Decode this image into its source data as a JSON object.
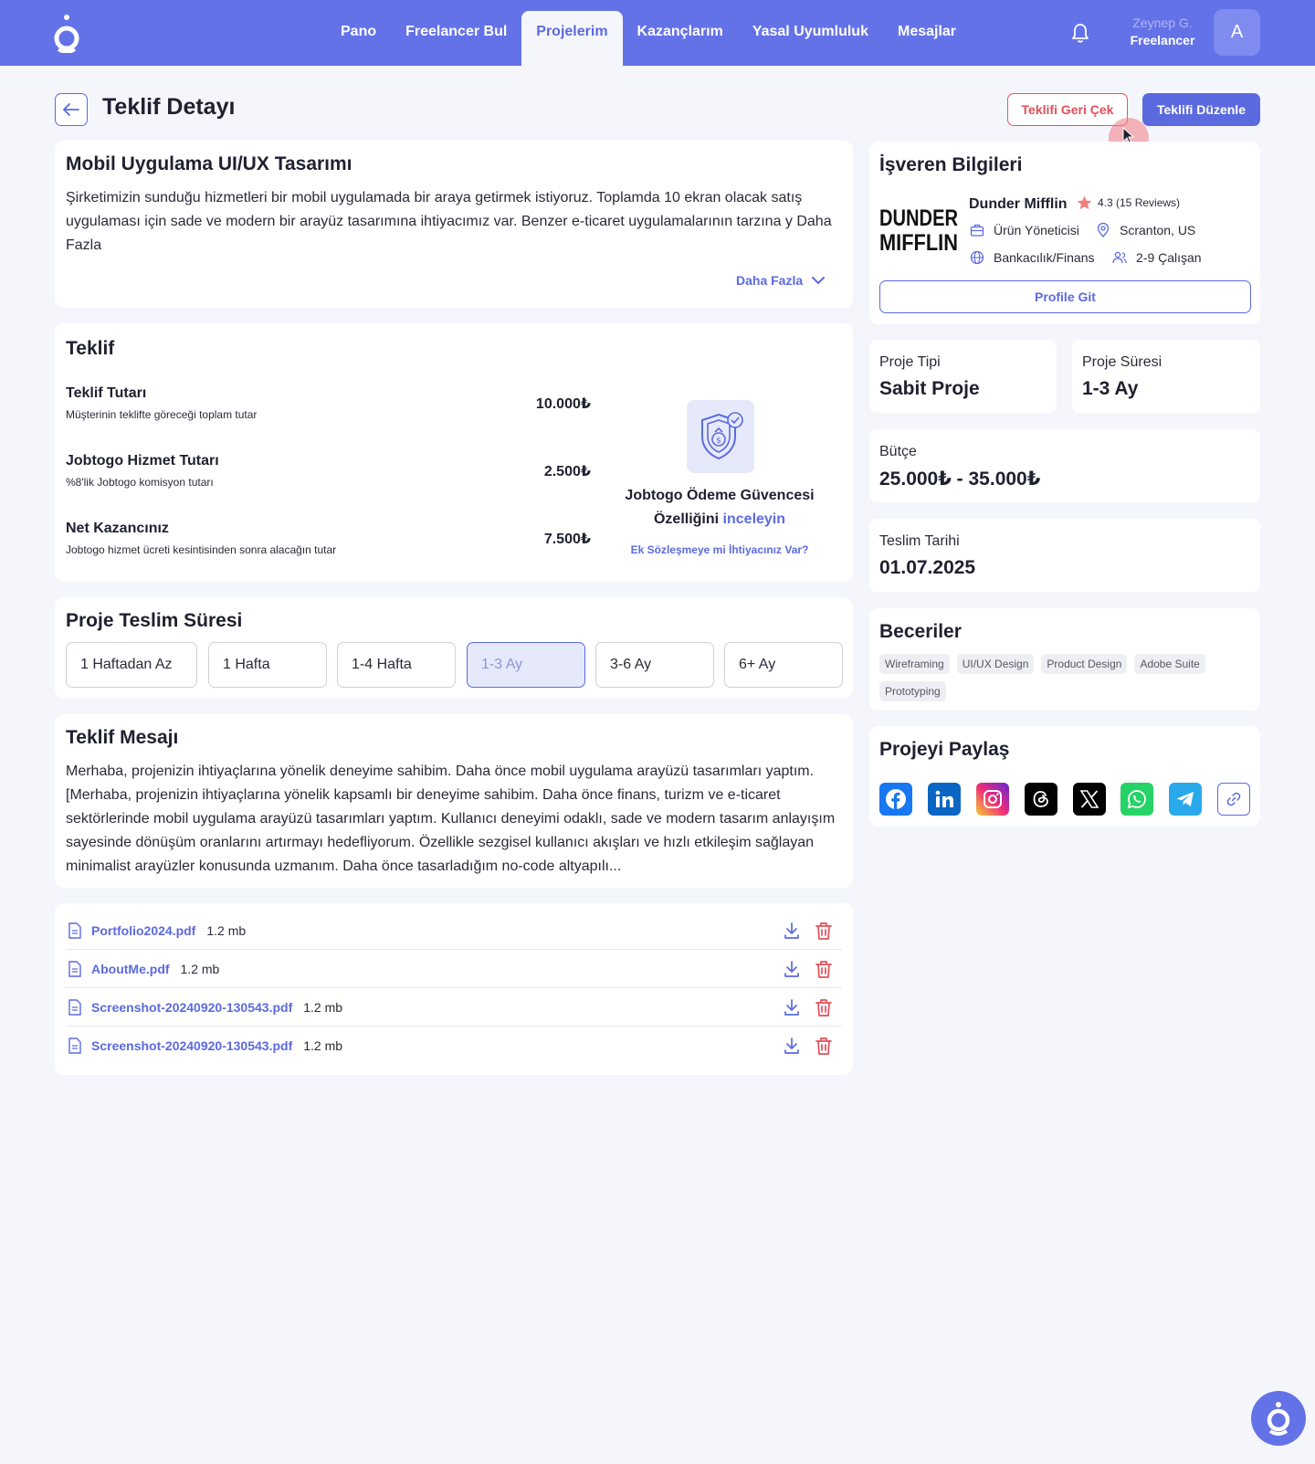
{
  "header": {
    "nav": [
      "Pano",
      "Freelancer Bul",
      "Projelerim",
      "Kazançlarım",
      "Yasal Uyumluluk",
      "Mesajlar"
    ],
    "active_nav": "Projelerim",
    "user_name": "Zeynep G.",
    "user_role": "Freelancer",
    "avatar_initial": "A"
  },
  "page": {
    "title": "Teklif Detayı",
    "withdraw_label": "Teklifi Geri Çek",
    "edit_label": "Teklifi Düzenle"
  },
  "project": {
    "title": "Mobil Uygulama UI/UX Tasarımı",
    "description": "Şirketimizin sunduğu hizmetleri bir mobil uygulamada bir araya getirmek istiyoruz. Toplamda 10 ekran olacak satış uygulaması için sade ve modern bir arayüz tasarımına ihtiyacımız var. Benzer e-ticaret uygulamalarının tarzına y Daha Fazla",
    "more_label": "Daha Fazla"
  },
  "offer": {
    "title": "Teklif",
    "rows": [
      {
        "label": "Teklif Tutarı",
        "sub": "Müşterinin teklifte göreceği toplam tutar",
        "value": "10.000₺"
      },
      {
        "label": "Jobtogo Hizmet Tutarı",
        "sub": "%8'lik Jobtogo komisyon tutarı",
        "value": "2.500₺"
      },
      {
        "label": "Net Kazancınız",
        "sub": "Jobtogo hizmet ücreti kesintisinden sonra alacağın tutar",
        "value": "7.500₺"
      }
    ],
    "guarantee_line1": "Jobtogo Ödeme Güvencesi",
    "guarantee_line2": "Özelliğini",
    "guarantee_link": "inceleyin",
    "contract_link": "Ek Sözleşmeye mi İhtiyacınız Var?"
  },
  "duration": {
    "title": "Proje Teslim Süresi",
    "options": [
      "1 Haftadan Az",
      "1 Hafta",
      "1-4 Hafta",
      "1-3 Ay",
      "3-6 Ay",
      "6+ Ay"
    ],
    "selected": "1-3 Ay"
  },
  "message": {
    "title": "Teklif Mesajı",
    "text": "Merhaba, projenizin ihtiyaçlarına yönelik  deneyime sahibim. Daha önce mobil uygulama arayüzü tasarımları yaptım.[Merhaba, projenizin ihtiyaçlarına yönelik kapsamlı bir deneyime sahibim. Daha önce finans, turizm ve e-ticaret sektörlerinde mobil uygulama arayüzü tasarımları yaptım. Kullanıcı deneyimi odaklı, sade ve modern tasarım anlayışım sayesinde dönüşüm oranlarını artırmayı hedefliyorum. Özellikle sezgisel kullanıcı akışları ve hızlı etkileşim sağlayan minimalist arayüzler konusunda uzmanım. Daha önce tasarladığım no-code altyapılı..."
  },
  "files": [
    {
      "name": "Portfolio2024.pdf",
      "size": "1.2 mb"
    },
    {
      "name": "AboutMe.pdf",
      "size": "1.2 mb"
    },
    {
      "name": "Screenshot-20240920-130543.pdf",
      "size": "1.2 mb"
    },
    {
      "name": "Screenshot-20240920-130543.pdf",
      "size": "1.2 mb"
    }
  ],
  "employer": {
    "title": "İşveren Bilgileri",
    "logo_text": [
      "DUNDER",
      "MIFFLIN"
    ],
    "company": "Dunder Mifflin",
    "rating": "4.3 (15 Reviews)",
    "role": "Ürün Yöneticisi",
    "location": "Scranton, US",
    "sector": "Bankacılık/Finans",
    "size": "2-9 Çalışan",
    "profile_button": "Profile Git"
  },
  "details": {
    "type_label": "Proje Tipi",
    "type_value": "Sabit Proje",
    "duration_label": "Proje Süresi",
    "duration_value": "1-3 Ay",
    "budget_label": "Bütçe",
    "budget_value": "25.000₺ - 35.000₺",
    "deadline_label": "Teslim Tarihi",
    "deadline_value": "01.07.2025"
  },
  "skills": {
    "title": "Beceriler",
    "items": [
      "Wireframing",
      "UI/UX Design",
      "Product Design",
      "Adobe Suite",
      "Prototyping"
    ]
  },
  "share": {
    "title": "Projeyi Paylaş",
    "icons": [
      "facebook-icon",
      "linkedin-icon",
      "instagram-icon",
      "threads-icon",
      "x-icon",
      "whatsapp-icon",
      "telegram-icon",
      "link-icon"
    ]
  },
  "colors": {
    "primary": "#5C6AE0",
    "header": "#6472E8",
    "danger": "#E34F5A",
    "background": "#F5F6FB"
  }
}
